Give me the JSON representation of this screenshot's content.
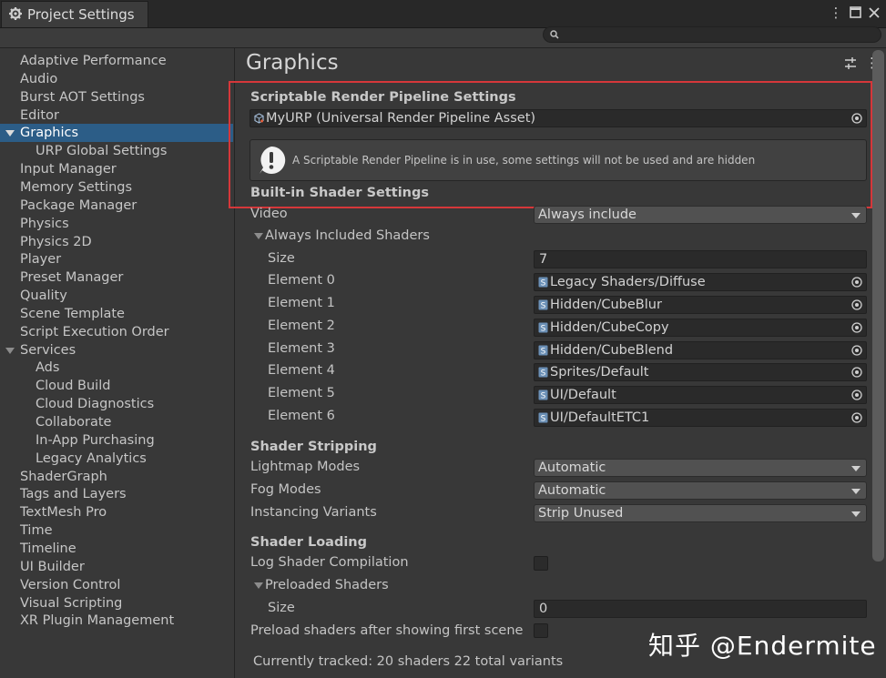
{
  "window": {
    "tab_title": "Project Settings",
    "icons": [
      "gear-icon",
      "more-vert-icon",
      "maximize-icon",
      "close-icon"
    ]
  },
  "search": {
    "placeholder": "",
    "icon": "search-icon"
  },
  "sidebar": {
    "items": [
      {
        "label": "Adaptive Performance"
      },
      {
        "label": "Audio"
      },
      {
        "label": "Burst AOT Settings"
      },
      {
        "label": "Editor"
      },
      {
        "label": "Graphics",
        "selected": true,
        "expanded": true
      },
      {
        "label": "URP Global Settings",
        "child": true
      },
      {
        "label": "Input Manager"
      },
      {
        "label": "Memory Settings"
      },
      {
        "label": "Package Manager"
      },
      {
        "label": "Physics"
      },
      {
        "label": "Physics 2D"
      },
      {
        "label": "Player"
      },
      {
        "label": "Preset Manager"
      },
      {
        "label": "Quality"
      },
      {
        "label": "Scene Template"
      },
      {
        "label": "Script Execution Order"
      },
      {
        "label": "Services",
        "expanded": true
      },
      {
        "label": "Ads",
        "child": true
      },
      {
        "label": "Cloud Build",
        "child": true
      },
      {
        "label": "Cloud Diagnostics",
        "child": true
      },
      {
        "label": "Collaborate",
        "child": true
      },
      {
        "label": "In-App Purchasing",
        "child": true
      },
      {
        "label": "Legacy Analytics",
        "child": true
      },
      {
        "label": "ShaderGraph"
      },
      {
        "label": "Tags and Layers"
      },
      {
        "label": "TextMesh Pro"
      },
      {
        "label": "Time"
      },
      {
        "label": "Timeline"
      },
      {
        "label": "UI Builder"
      },
      {
        "label": "Version Control"
      },
      {
        "label": "Visual Scripting"
      },
      {
        "label": "XR Plugin Management"
      }
    ]
  },
  "main": {
    "title": "Graphics",
    "srp": {
      "heading": "Scriptable Render Pipeline Settings",
      "asset": "MyURP (Universal Render Pipeline Asset)",
      "warning": "A Scriptable Render Pipeline is in use, some settings will not be used and are hidden"
    },
    "builtin": {
      "heading": "Built-in Shader Settings",
      "video_label": "Video",
      "video_value": "Always include",
      "always_included_label": "Always Included Shaders",
      "size_label": "Size",
      "size_value": "7",
      "elements": [
        {
          "label": "Element 0",
          "value": "Legacy Shaders/Diffuse"
        },
        {
          "label": "Element 1",
          "value": "Hidden/CubeBlur"
        },
        {
          "label": "Element 2",
          "value": "Hidden/CubeCopy"
        },
        {
          "label": "Element 3",
          "value": "Hidden/CubeBlend"
        },
        {
          "label": "Element 4",
          "value": "Sprites/Default"
        },
        {
          "label": "Element 5",
          "value": "UI/Default"
        },
        {
          "label": "Element 6",
          "value": "UI/DefaultETC1"
        }
      ]
    },
    "stripping": {
      "heading": "Shader Stripping",
      "rows": [
        {
          "label": "Lightmap Modes",
          "value": "Automatic"
        },
        {
          "label": "Fog Modes",
          "value": "Automatic"
        },
        {
          "label": "Instancing Variants",
          "value": "Strip Unused"
        }
      ]
    },
    "loading": {
      "heading": "Shader Loading",
      "log_label": "Log Shader Compilation",
      "log_checked": false,
      "preloaded_label": "Preloaded Shaders",
      "size_label": "Size",
      "size_value": "0",
      "preload_after_label": "Preload shaders after showing first scene",
      "preload_after_checked": false,
      "tracked": "Currently tracked: 20 shaders 22 total variants"
    }
  },
  "watermark": "知乎 @Endermite",
  "colors": {
    "selection": "#2c5d87",
    "highlight_border": "#d6373a",
    "background": "#383838"
  }
}
